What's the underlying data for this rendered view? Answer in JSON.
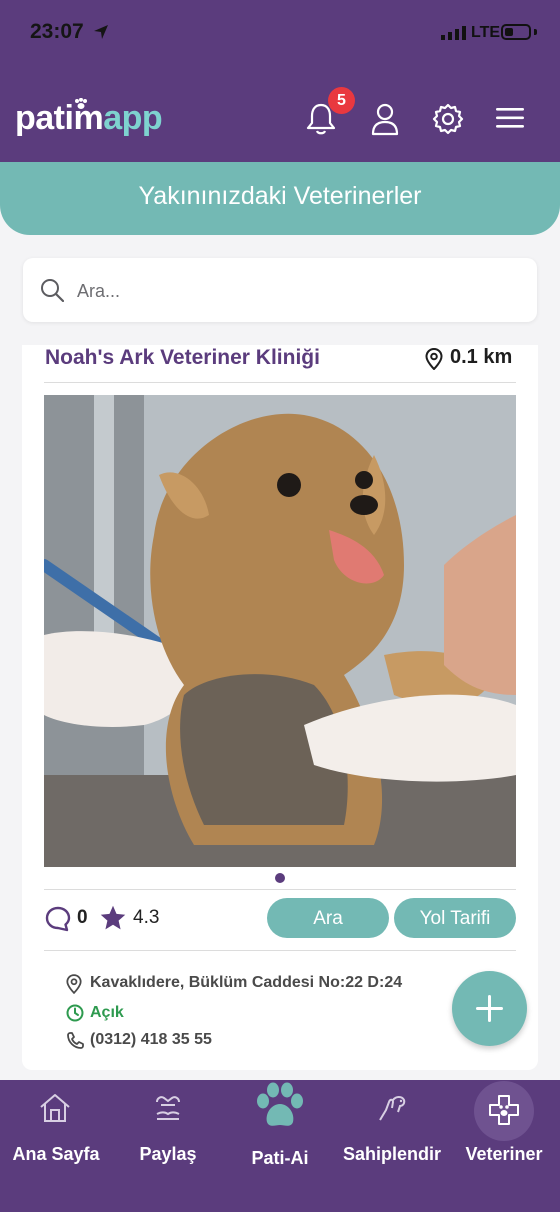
{
  "status_bar": {
    "time": "23:07",
    "network": "LTE"
  },
  "header": {
    "logo_part1": "patim",
    "logo_part2": "app",
    "notification_count": "5",
    "icons": [
      "bell-icon",
      "user-icon",
      "gear-icon",
      "menu-icon"
    ]
  },
  "banner": {
    "title": "Yakınınızdaki Veterinerler"
  },
  "search": {
    "placeholder": "Ara..."
  },
  "clinic": {
    "name": "Noah's Ark Veteriner Kliniği",
    "distance": "0.1 km",
    "comment_count": "0",
    "rating": "4.3",
    "call_button": "Ara",
    "directions_button": "Yol Tarifi",
    "address": "Kavaklıdere, Büklüm Caddesi No:22 D:24",
    "status": "Açık",
    "phone": "(0312) 418 35 55"
  },
  "tabs": [
    {
      "label": "Ana Sayfa",
      "icon": "home-icon"
    },
    {
      "label": "Paylaş",
      "icon": "share-hands-icon"
    },
    {
      "label": "Pati-Ai",
      "icon": "paw-icon"
    },
    {
      "label": "Sahiplendir",
      "icon": "adopt-icon"
    },
    {
      "label": "Veteriner",
      "icon": "vet-icon"
    }
  ],
  "colors": {
    "primary": "#5b3c7d",
    "accent": "#73b9b4",
    "logo_accent": "#7ed3cf",
    "badge": "#e9383f",
    "open_status": "#2e9a4f"
  }
}
